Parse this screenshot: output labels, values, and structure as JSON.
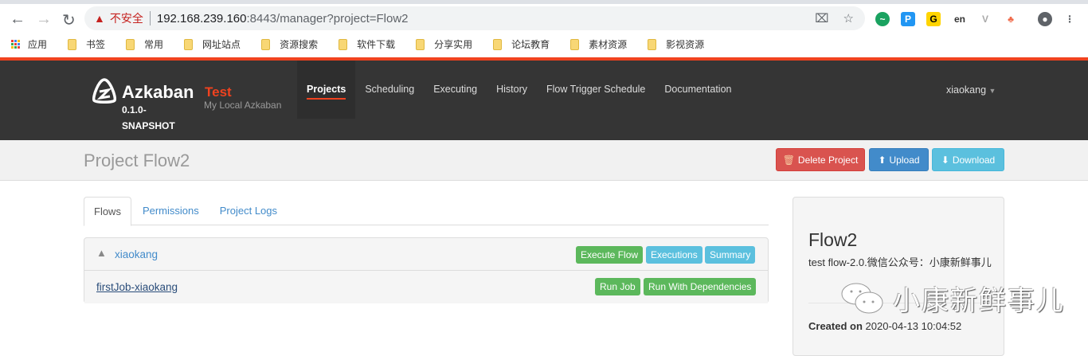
{
  "browser": {
    "security_label": "不安全",
    "url_host": "192.168.239.160",
    "url_rest": ":8443/manager?project=Flow2",
    "bookmarks": [
      "应用",
      "书签",
      "常用",
      "网址站点",
      "资源搜索",
      "软件下载",
      "分享实用",
      "论坛教育",
      "素材资源",
      "影视资源"
    ]
  },
  "navbar": {
    "brand": "Azkaban",
    "version_line1": "0.1.0-",
    "version_line2": "SNAPSHOT",
    "env_name": "Test",
    "env_desc": "My Local Azkaban",
    "items": [
      "Projects",
      "Scheduling",
      "Executing",
      "History",
      "Flow Trigger Schedule",
      "Documentation"
    ],
    "user": "xiaokang"
  },
  "header": {
    "title": "Project Flow2",
    "delete": "Delete Project",
    "upload": "Upload",
    "download": "Download"
  },
  "tabs": [
    "Flows",
    "Permissions",
    "Project Logs"
  ],
  "flow": {
    "name": "xiaokang",
    "execute": "Execute Flow",
    "executions": "Executions",
    "summary": "Summary",
    "job": "firstJob-xiaokang",
    "run_job": "Run Job",
    "run_deps": "Run With Dependencies"
  },
  "sidebar": {
    "title": "Flow2",
    "description": "test flow-2.0.微信公众号：小康新鲜事儿",
    "created_label": "Created on",
    "created_value": "2020-04-13 10:04:52"
  },
  "watermark": "小康新鲜事儿",
  "colors": {
    "accent": "#f0421f",
    "navbar": "#353535",
    "danger": "#d9534f",
    "primary": "#428bca",
    "info": "#5bc0de",
    "success": "#5cb85c"
  }
}
